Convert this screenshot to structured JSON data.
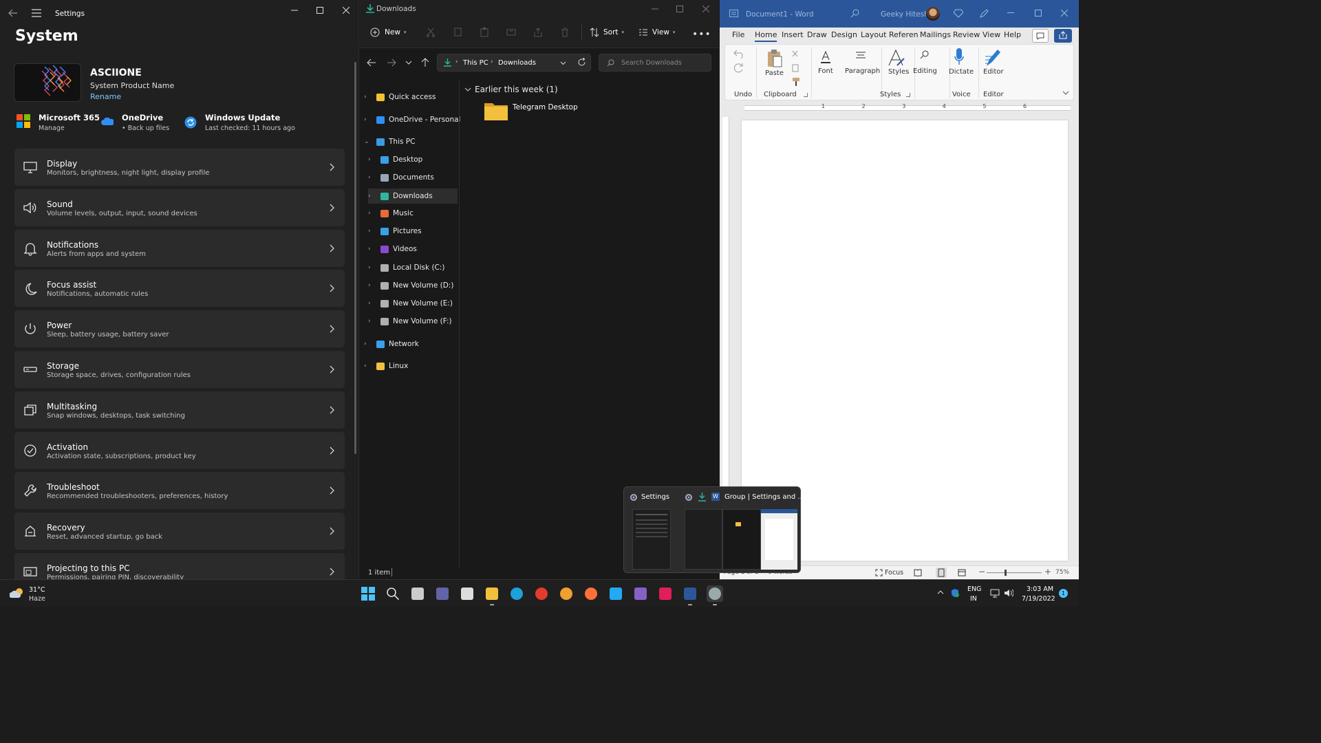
{
  "settings": {
    "window_title": "Settings",
    "page_title": "System",
    "device_name": "ASCIIONE",
    "product_name": "System Product Name",
    "rename": "Rename",
    "quick": [
      {
        "title": "Microsoft 365",
        "sub": "Manage"
      },
      {
        "title": "OneDrive",
        "sub": "• Back up files"
      },
      {
        "title": "Windows Update",
        "sub": "Last checked: 11 hours ago"
      }
    ],
    "items": [
      {
        "title": "Display",
        "sub": "Monitors, brightness, night light, display profile",
        "icon": "monitor-icon"
      },
      {
        "title": "Sound",
        "sub": "Volume levels, output, input, sound devices",
        "icon": "speaker-icon"
      },
      {
        "title": "Notifications",
        "sub": "Alerts from apps and system",
        "icon": "bell-icon"
      },
      {
        "title": "Focus assist",
        "sub": "Notifications, automatic rules",
        "icon": "moon-icon"
      },
      {
        "title": "Power",
        "sub": "Sleep, battery usage, battery saver",
        "icon": "power-icon"
      },
      {
        "title": "Storage",
        "sub": "Storage space, drives, configuration rules",
        "icon": "drive-icon"
      },
      {
        "title": "Multitasking",
        "sub": "Snap windows, desktops, task switching",
        "icon": "multitask-icon"
      },
      {
        "title": "Activation",
        "sub": "Activation state, subscriptions, product key",
        "icon": "check-circle-icon"
      },
      {
        "title": "Troubleshoot",
        "sub": "Recommended troubleshooters, preferences, history",
        "icon": "wrench-icon"
      },
      {
        "title": "Recovery",
        "sub": "Reset, advanced startup, go back",
        "icon": "recovery-icon"
      },
      {
        "title": "Projecting to this PC",
        "sub": "Permissions, pairing PIN, discoverability",
        "icon": "project-icon"
      }
    ]
  },
  "explorer": {
    "window_title": "Downloads",
    "toolbar": {
      "new": "New",
      "sort": "Sort",
      "view": "View"
    },
    "breadcrumb": [
      "This PC",
      "Downloads"
    ],
    "search_placeholder": "Search Downloads",
    "nav": [
      {
        "label": "Quick access",
        "icon": "star-icon"
      },
      {
        "label": "OneDrive - Personal",
        "icon": "cloud-icon"
      },
      {
        "label": "This PC",
        "icon": "pc-icon"
      },
      {
        "label": "Desktop",
        "icon": "desktop-icon"
      },
      {
        "label": "Documents",
        "icon": "documents-icon"
      },
      {
        "label": "Downloads",
        "icon": "download-icon"
      },
      {
        "label": "Music",
        "icon": "music-icon"
      },
      {
        "label": "Pictures",
        "icon": "pictures-icon"
      },
      {
        "label": "Videos",
        "icon": "videos-icon"
      },
      {
        "label": "Local Disk (C:)",
        "icon": "disk-icon"
      },
      {
        "label": "New Volume (D:)",
        "icon": "disk-icon"
      },
      {
        "label": "New Volume (E:)",
        "icon": "disk-icon"
      },
      {
        "label": "New Volume (F:)",
        "icon": "disk-icon"
      },
      {
        "label": "Network",
        "icon": "network-icon"
      },
      {
        "label": "Linux",
        "icon": "linux-icon"
      }
    ],
    "group_header": "Earlier this week (1)",
    "files": [
      {
        "name": "Telegram Desktop",
        "icon": "folder-icon"
      }
    ],
    "status": "1 item"
  },
  "word": {
    "title": "Document1 - Word",
    "user": "Geeky Hitesh",
    "tabs": [
      "File",
      "Home",
      "Insert",
      "Draw",
      "Design",
      "Layout",
      "Referen",
      "Mailings",
      "Review",
      "View",
      "Help"
    ],
    "active_tab": "Home",
    "ribbon": {
      "undo": "Undo",
      "paste": "Paste",
      "clipboard": "Clipboard",
      "font": "Font",
      "paragraph": "Paragraph",
      "styles": "Styles",
      "styles_group": "Styles",
      "editing": "Editing",
      "dictate": "Dictate",
      "voice": "Voice",
      "editor": "Editor",
      "editor_group": "Editor"
    },
    "ruler_numbers": [
      "1",
      "2",
      "3",
      "4",
      "5",
      "6"
    ],
    "status": {
      "page": "Page 1 of 1",
      "words": "0 words",
      "focus": "Focus",
      "zoom": "75%"
    }
  },
  "task_preview": {
    "item1": "Settings",
    "item2": "Group | Settings and ..."
  },
  "taskbar": {
    "weather_temp": "31°C",
    "weather_desc": "Haze",
    "lang": "ENG",
    "region": "IN",
    "time": "3:03 AM",
    "date": "7/19/2022",
    "notif_count": "1"
  },
  "colors": {
    "accent": "#4cc2ff",
    "word_blue": "#2b579a",
    "folder": "#f3c03e"
  }
}
